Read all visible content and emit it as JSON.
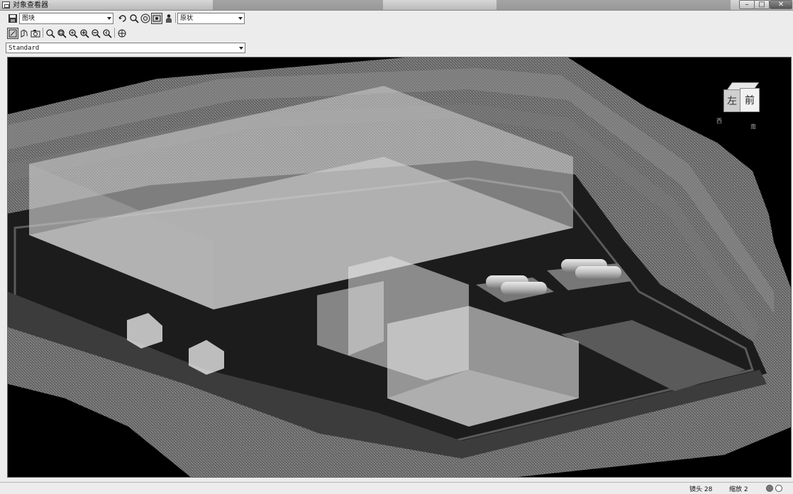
{
  "window": {
    "title": "对象查看器",
    "controls": [
      "minimize",
      "maximize",
      "close"
    ]
  },
  "toolbar": {
    "layer_select": "图块",
    "visual_select": "原状",
    "row1_icons": [
      "save-icon",
      "orbit-icon",
      "zoom-icon",
      "steering-wheel-icon",
      "view-icon",
      "person-icon"
    ],
    "row2_icons": [
      "free-orbit-icon",
      "constrained-orbit-icon",
      "camera-icon",
      "zoom-realtime-icon",
      "zoom-window-icon",
      "zoom-extents-icon",
      "zoom-in-icon",
      "zoom-out-icon",
      "zoom-previous-icon",
      "pan-icon"
    ],
    "style_select": "Standard"
  },
  "viewcube": {
    "left_face": "左",
    "front_face": "前",
    "compass": [
      "西",
      "南"
    ]
  },
  "status": {
    "lens": "镜头 28",
    "zoom": "缩放 2"
  }
}
